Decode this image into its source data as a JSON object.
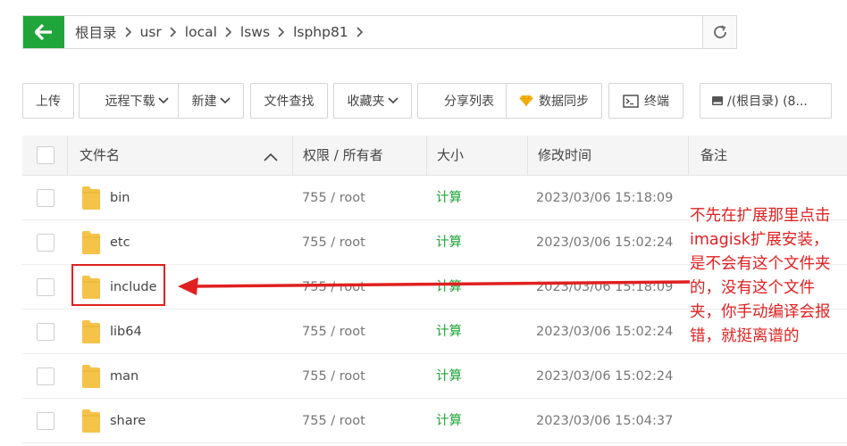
{
  "colors": {
    "accent": "#20a53a",
    "annotation": "#e02020",
    "folder": "#f5c34a"
  },
  "pathbar": {
    "back_icon": "arrow-left-icon",
    "crumbs": [
      "根目录",
      "usr",
      "local",
      "lsws",
      "lsphp81"
    ],
    "refresh_icon": "refresh-icon"
  },
  "toolbar": {
    "upload": "上传",
    "remote_download": "远程下载",
    "new": "新建",
    "find": "文件查找",
    "favorites": "收藏夹",
    "share_list": "分享列表",
    "sync": "数据同步",
    "terminal": "终端",
    "disk": "/(根目录) (8..."
  },
  "table": {
    "headers": {
      "name": "文件名",
      "perm": "权限 / 所有者",
      "size": "大小",
      "mtime": "修改时间",
      "note": "备注"
    },
    "rows": [
      {
        "name": "bin",
        "perm": "755 / root",
        "size": "计算",
        "mtime": "2023/03/06 15:18:09"
      },
      {
        "name": "etc",
        "perm": "755 / root",
        "size": "计算",
        "mtime": "2023/03/06 15:02:24"
      },
      {
        "name": "include",
        "perm": "755 / root",
        "size": "计算",
        "mtime": "2023/03/06 15:18:09"
      },
      {
        "name": "lib64",
        "perm": "755 / root",
        "size": "计算",
        "mtime": "2023/03/06 15:02:24"
      },
      {
        "name": "man",
        "perm": "755 / root",
        "size": "计算",
        "mtime": "2023/03/06 15:02:24"
      },
      {
        "name": "share",
        "perm": "755 / root",
        "size": "计算",
        "mtime": "2023/03/06 15:04:37"
      }
    ]
  },
  "annotation": {
    "text": "不先在扩展那里点击imagisk扩展安装，是不会有这个文件夹的，没有这个文件夹，你手动编译会报错，就挺离谱的"
  }
}
